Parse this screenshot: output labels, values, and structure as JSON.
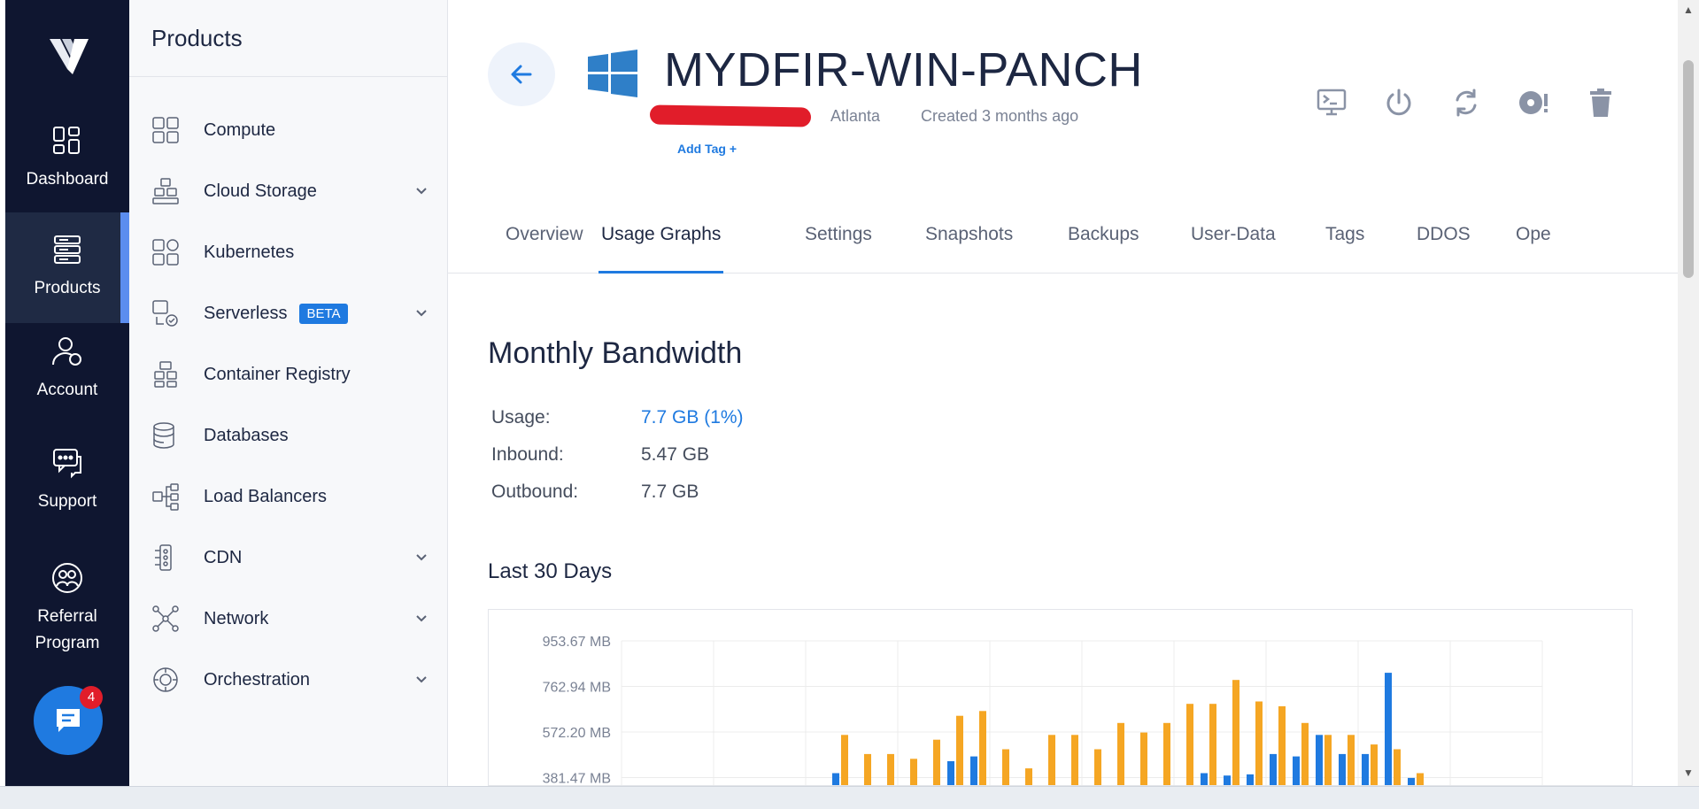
{
  "rail": {
    "items": [
      {
        "label": "Dashboard"
      },
      {
        "label": "Products"
      },
      {
        "label": "Account"
      },
      {
        "label": "Support"
      },
      {
        "label": "Referral Program"
      }
    ],
    "chat_badge": "4"
  },
  "menu": {
    "title": "Products",
    "items": [
      {
        "label": "Compute",
        "icon": "compute-icon",
        "expandable": false
      },
      {
        "label": "Cloud Storage",
        "icon": "cloud-storage-icon",
        "expandable": true
      },
      {
        "label": "Kubernetes",
        "icon": "kubernetes-icon",
        "expandable": false
      },
      {
        "label": "Serverless",
        "icon": "serverless-icon",
        "expandable": true,
        "badge": "BETA"
      },
      {
        "label": "Container Registry",
        "icon": "container-registry-icon",
        "expandable": false
      },
      {
        "label": "Databases",
        "icon": "database-icon",
        "expandable": false
      },
      {
        "label": "Load Balancers",
        "icon": "load-balancer-icon",
        "expandable": false
      },
      {
        "label": "CDN",
        "icon": "cdn-icon",
        "expandable": true
      },
      {
        "label": "Network",
        "icon": "network-icon",
        "expandable": true
      },
      {
        "label": "Orchestration",
        "icon": "orchestration-icon",
        "expandable": true
      }
    ]
  },
  "server": {
    "name": "MYDFIR-WIN-PANCH",
    "location": "Atlanta",
    "created": "Created 3 months ago",
    "add_tag": "Add Tag +"
  },
  "actions": [
    "console-icon",
    "power-icon",
    "restart-icon",
    "iso-icon",
    "trash-icon"
  ],
  "tabs": [
    {
      "label": "Overview",
      "active": false
    },
    {
      "label": "Usage Graphs",
      "active": true
    },
    {
      "label": "Settings",
      "active": false
    },
    {
      "label": "Snapshots",
      "active": false
    },
    {
      "label": "Backups",
      "active": false
    },
    {
      "label": "User-Data",
      "active": false
    },
    {
      "label": "Tags",
      "active": false
    },
    {
      "label": "DDOS",
      "active": false
    },
    {
      "label": "Ope",
      "active": false
    }
  ],
  "bandwidth": {
    "title": "Monthly Bandwidth",
    "rows": [
      {
        "key": "Usage:",
        "value": "7.7 GB (1%)"
      },
      {
        "key": "Inbound:",
        "value": "5.47 GB"
      },
      {
        "key": "Outbound:",
        "value": "7.7 GB"
      }
    ]
  },
  "last30_title": "Last 30 Days",
  "colors": {
    "accent": "#1f7ae0",
    "inbound": "#1f7ae0",
    "outbound": "#f5a623",
    "rail": "#0f1630"
  },
  "chart_data": {
    "type": "bar",
    "yticks": [
      "953.67 MB",
      "762.94 MB",
      "572.20 MB",
      "381.47 MB"
    ],
    "ytick_values_mb": [
      953.67,
      762.94,
      572.2,
      381.47
    ],
    "ylim_mb": [
      381.47,
      953.67
    ],
    "series": [
      {
        "values": [
          0,
          0,
          0,
          0,
          0,
          0,
          0,
          0,
          0,
          400,
          0,
          0,
          0,
          0,
          450,
          470,
          0,
          0,
          0,
          0,
          0,
          0,
          0,
          0,
          0,
          400,
          390,
          395,
          480,
          470,
          560,
          480,
          480,
          820,
          380,
          0,
          0,
          0,
          0,
          0
        ]
      },
      {
        "values": [
          0,
          0,
          0,
          0,
          0,
          0,
          0,
          0,
          0,
          560,
          480,
          480,
          460,
          540,
          640,
          660,
          500,
          420,
          560,
          560,
          500,
          610,
          570,
          610,
          690,
          690,
          790,
          700,
          680,
          610,
          560,
          560,
          520,
          500,
          400,
          0,
          0,
          0,
          0,
          0
        ]
      }
    ]
  }
}
